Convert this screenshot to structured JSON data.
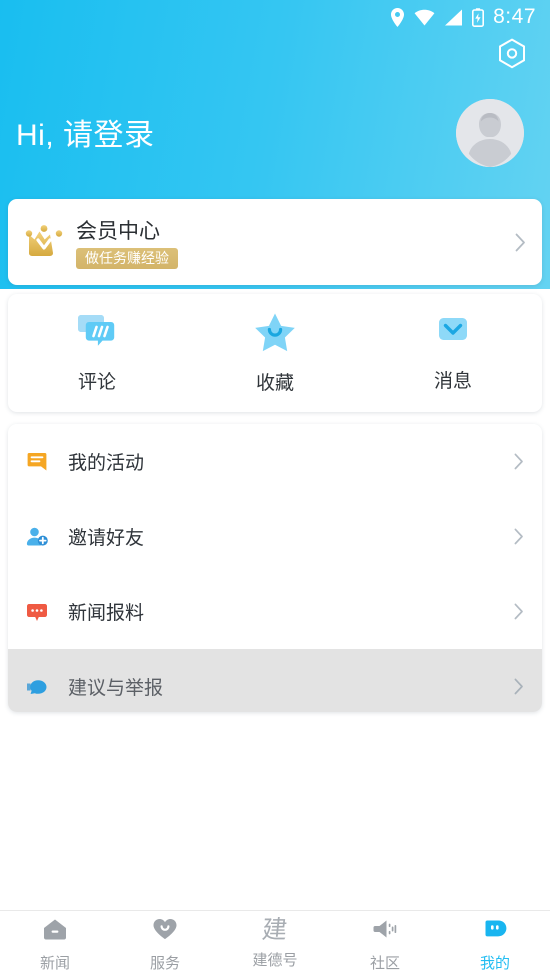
{
  "theme": {
    "brand": "#23bdf2",
    "header_gradient_start": "#19bef0",
    "header_gradient_end": "#64d3f2",
    "badge_gold": "#d6b96f",
    "pressed_row": "#e3e3e3"
  },
  "statusbar": {
    "time": "8:47",
    "icons": [
      "location-icon",
      "wifi-icon",
      "signal-icon",
      "battery-charging-icon"
    ]
  },
  "header": {
    "settings_icon": "settings-hexagon-icon",
    "greeting": "Hi, 请登录",
    "avatar_icon": "default-avatar-icon"
  },
  "member_card": {
    "icon": "crown-icon",
    "title": "会员中心",
    "badge": "做任务赚经验",
    "chevron": "chevron-right-icon"
  },
  "shortcuts": [
    {
      "label": "评论",
      "icon": "comment-bubble-icon"
    },
    {
      "label": "收藏",
      "icon": "star-icon"
    },
    {
      "label": "消息",
      "icon": "envelope-icon"
    }
  ],
  "menu": [
    {
      "label": "我的活动",
      "icon": "activity-note-icon",
      "color": "#f5a623",
      "pressed": false
    },
    {
      "label": "邀请好友",
      "icon": "add-friend-icon",
      "color": "#3aa6e8",
      "pressed": false
    },
    {
      "label": "新闻报料",
      "icon": "news-tip-icon",
      "color": "#ef5a43",
      "pressed": false
    },
    {
      "label": "建议与举报",
      "icon": "feedback-bubble-icon",
      "color": "#2e9fe0",
      "pressed": true
    }
  ],
  "tabbar": [
    {
      "label": "新闻",
      "icon": "home-icon",
      "active": false
    },
    {
      "label": "服务",
      "icon": "heart-icon",
      "active": false
    },
    {
      "label": "建德号",
      "icon": "jian-character-icon",
      "active": false
    },
    {
      "label": "社区",
      "icon": "megaphone-icon",
      "active": false
    },
    {
      "label": "我的",
      "icon": "profile-icon",
      "active": true
    }
  ]
}
